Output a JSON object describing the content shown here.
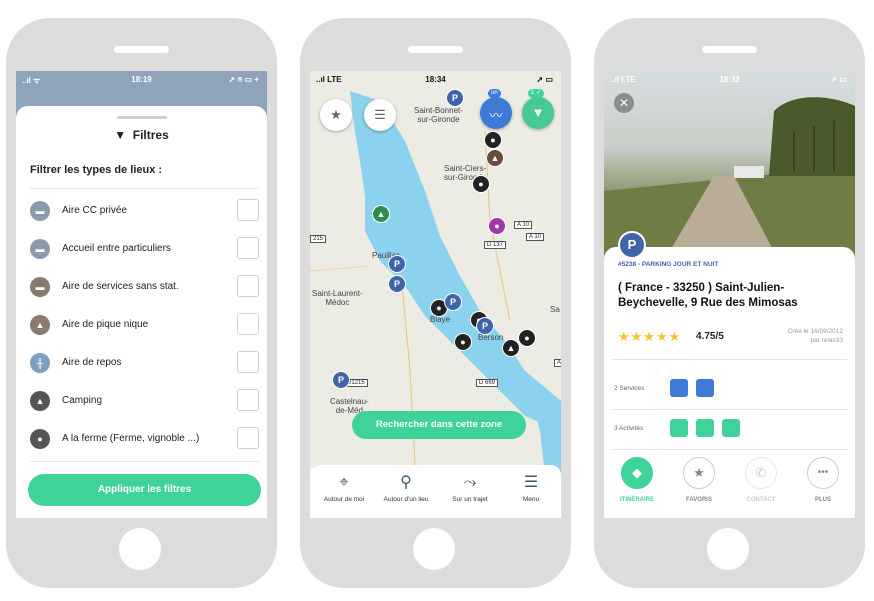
{
  "phone1": {
    "status": {
      "left": "..ıl ᯤ",
      "time": "18:19",
      "right": "➚ ⌾ ▭ +"
    },
    "title": "Filtres",
    "subtitle": "Filtrer les types de lieux :",
    "filters": [
      {
        "label": "Aire CC privée",
        "icon": "camper-icon"
      },
      {
        "label": "Accueil entre particuliers",
        "icon": "camper-icon"
      },
      {
        "label": "Aire de services sans stat.",
        "icon": "service-icon"
      },
      {
        "label": "Aire de pique nique",
        "icon": "picnic-icon"
      },
      {
        "label": "Aire de repos",
        "icon": "road-icon"
      },
      {
        "label": "Camping",
        "icon": "tent-icon"
      },
      {
        "label": "A la ferme (Ferme, vignoble ...)",
        "icon": "tractor-icon"
      }
    ],
    "apply": "Appliquer les filtres"
  },
  "phone2": {
    "status": {
      "left": "..ıl LTE",
      "time": "18:34",
      "right": "➚ ▭"
    },
    "places": {
      "saint_bonnet": "Saint-Bonnet-\nsur-Gironde",
      "saint_ciers": "Saint-Ciers-\nsur-Gironde",
      "pauillac": "Pauillac",
      "saint_laurent": "Saint-Laurent-\nMédoc",
      "blaye": "Blaye",
      "berson": "Berson",
      "castelnau": "Castelnau-\nde-Méd",
      "sa": "Sa"
    },
    "roads": {
      "a10a": "A 10",
      "a10b": "A 10",
      "d137": "D 137",
      "r215": "215",
      "d1215": "D1215",
      "d669": "D 669",
      "a": "A"
    },
    "badge_on": "on",
    "badge_filter": "1 ✓",
    "search_button": "Rechercher dans cette zone",
    "nav": [
      {
        "label": "Autour de moi",
        "icon": "⌖"
      },
      {
        "label": "Autour d'un lieu",
        "icon": "⚲"
      },
      {
        "label": "Sur un trajet",
        "icon": "⤳"
      },
      {
        "label": "Menu",
        "icon": "☰"
      }
    ]
  },
  "phone3": {
    "status": {
      "left": "..ıl LTE",
      "time": "18:32",
      "right": "➚ ▭"
    },
    "category": "#5238 - PARKING JOUR ET NUIT",
    "address": "( France - 33250 ) Saint-Julien-Beychevelle, 9 Rue des Mimosas",
    "stars": "★★★★★",
    "rating": "4.75/5",
    "created": "Créé le 16/09/2012\npar relas33",
    "services_label": "2 Services",
    "activities_label": "3 Activités",
    "actions": [
      {
        "label": "ITINÉRAIRE",
        "icon": "◆"
      },
      {
        "label": "FAVORIS",
        "icon": "★"
      },
      {
        "label": "CONTACT",
        "icon": "✆"
      },
      {
        "label": "PLUS",
        "icon": "•••"
      }
    ],
    "colors": {
      "accent": "#3fd39a",
      "pin_blue": "#3f64a8",
      "star": "#f2c230"
    }
  }
}
